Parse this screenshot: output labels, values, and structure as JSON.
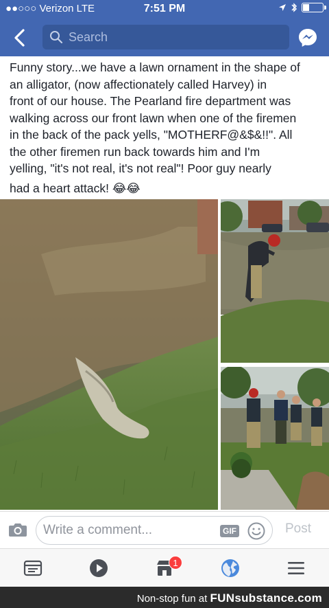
{
  "status_bar": {
    "carrier": "●●○○○ Verizon  LTE",
    "time": "7:51 PM"
  },
  "header": {
    "search_placeholder": "Search",
    "back_icon": "chevron-left-icon",
    "messenger_icon": "messenger-icon"
  },
  "post": {
    "lines": [
      "Funny story...we have a lawn ornament in the shape of",
      "an alligator,  (now affectionately called Harvey) in",
      "front of our house.  The Pearland fire department was",
      "walking across our front lawn when one of the firemen",
      "in the back of the pack yells, \"MOTHERF@&$&!!\".   All",
      "the other firemen run back towards him and I'm",
      "yelling, \"it's not real, it's not real\"!   Poor guy nearly",
      "had a heart attack! 😂😂"
    ]
  },
  "composer": {
    "placeholder": "Write a comment...",
    "gif_label": "GIF",
    "post_label": "Post"
  },
  "tabbar": {
    "notification_count": "1"
  },
  "footer": {
    "prefix": "Non-stop fun at ",
    "brand": "FUNsubstance.com"
  },
  "colors": {
    "header": "#4267b2",
    "search": "#365899",
    "badge": "#fa3e3e",
    "footer": "#2b2b2b"
  }
}
